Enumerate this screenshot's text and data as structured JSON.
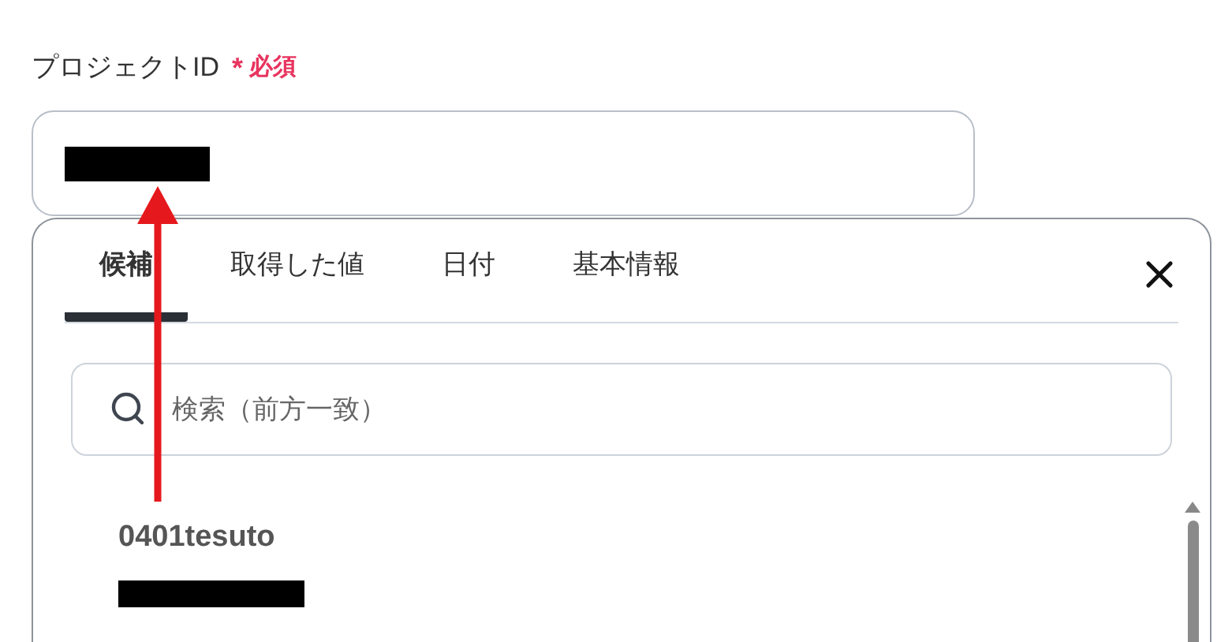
{
  "field": {
    "label": "プロジェクトID",
    "required_mark": "*",
    "required_text": "必須"
  },
  "picker": {
    "tabs": [
      {
        "label": "候補",
        "selected": true
      },
      {
        "label": "取得した値",
        "selected": false
      },
      {
        "label": "日付",
        "selected": false
      },
      {
        "label": "基本情報",
        "selected": false
      }
    ],
    "search": {
      "placeholder": "検索（前方一致）"
    },
    "items": [
      {
        "title": "0401tesuto"
      }
    ]
  }
}
